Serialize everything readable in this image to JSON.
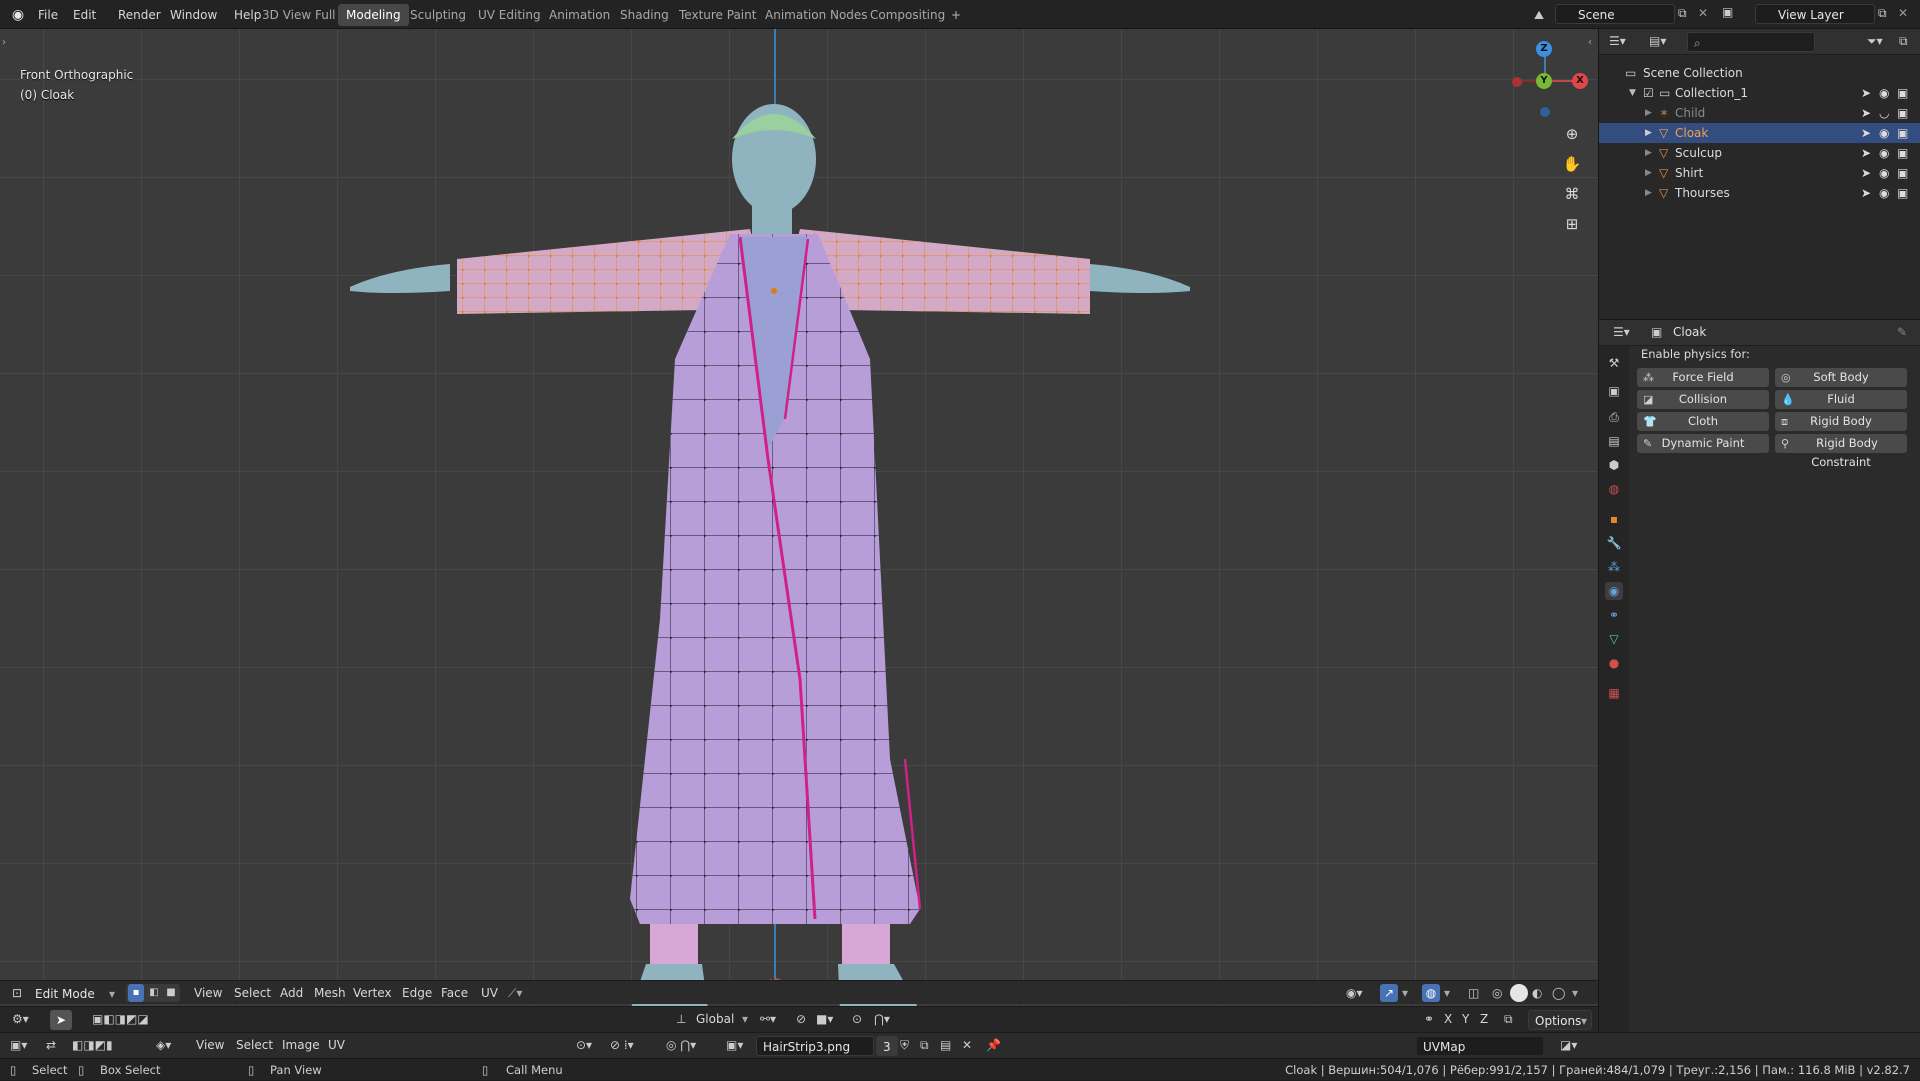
{
  "top_menu": [
    "File",
    "Edit",
    "Render",
    "Window",
    "Help"
  ],
  "workspace_tabs": [
    {
      "label": "3D View Full",
      "active": false
    },
    {
      "label": "Modeling",
      "active": true
    },
    {
      "label": "Sculpting",
      "active": false
    },
    {
      "label": "UV Editing",
      "active": false
    },
    {
      "label": "Animation",
      "active": false
    },
    {
      "label": "Shading",
      "active": false
    },
    {
      "label": "Texture Paint",
      "active": false
    },
    {
      "label": "Animation Nodes",
      "active": false
    },
    {
      "label": "Compositing",
      "active": false
    }
  ],
  "add_tab_glyph": "+",
  "scene": {
    "value": "Scene"
  },
  "view_layer": {
    "value": "View Layer"
  },
  "viewport": {
    "view_name": "Front Orthographic",
    "object_label": "(0) Cloak",
    "gizmo_axes": {
      "z": "Z",
      "y": "Y",
      "x": "X"
    }
  },
  "outliner": {
    "root": "Scene Collection",
    "collection": "Collection_1",
    "items": [
      {
        "name": "Child",
        "selected": false,
        "dim": true
      },
      {
        "name": "Cloak",
        "selected": true,
        "dim": false
      },
      {
        "name": "Sculcup",
        "selected": false,
        "dim": false
      },
      {
        "name": "Shirt",
        "selected": false,
        "dim": false
      },
      {
        "name": "Thourses",
        "selected": false,
        "dim": false
      }
    ]
  },
  "properties": {
    "object_name": "Cloak",
    "section_label": "Enable physics for:",
    "buttons": [
      {
        "label": "Force Field",
        "icon": "force-field-icon"
      },
      {
        "label": "Soft Body",
        "icon": "soft-body-icon"
      },
      {
        "label": "Collision",
        "icon": "collision-icon"
      },
      {
        "label": "Fluid",
        "icon": "fluid-icon"
      },
      {
        "label": "Cloth",
        "icon": "cloth-icon"
      },
      {
        "label": "Rigid Body",
        "icon": "rigid-body-icon"
      },
      {
        "label": "Dynamic Paint",
        "icon": "dynamic-paint-icon"
      },
      {
        "label": "Rigid Body Constraint",
        "icon": "rigid-body-constraint-icon"
      }
    ]
  },
  "viewport_header": {
    "mode": "Edit Mode",
    "menus": [
      "View",
      "Select",
      "Add",
      "Mesh",
      "Vertex",
      "Edge",
      "Face",
      "UV"
    ]
  },
  "tool_header": {
    "orientation": "Global",
    "options_label": "Options",
    "axes": [
      "X",
      "Y",
      "Z"
    ]
  },
  "uv_header": {
    "menus": [
      "View",
      "Select",
      "Image",
      "UV"
    ],
    "image_name": "HairStrip3.png",
    "users": "3",
    "uvmap": "UVMap"
  },
  "statusbar": {
    "select": "Select",
    "box_select": "Box Select",
    "pan_view": "Pan View",
    "call_menu": "Call Menu",
    "stats": "Cloak | Вершин:504/1,076 | Рёбер:991/2,157 | Граней:484/1,079 | Треуг.:2,156 | Пам.: 116.8 MiB | v2.82.7"
  },
  "colors": {
    "accent_tab": "#474747",
    "selection": "#334d80",
    "cloak": "#b89ed8",
    "skin": "#8fb4c0",
    "sleeve_edge": "#e08a2c",
    "seam": "#d0208a",
    "pants": "#d7a8d6",
    "cap": "#9ad0a0"
  }
}
